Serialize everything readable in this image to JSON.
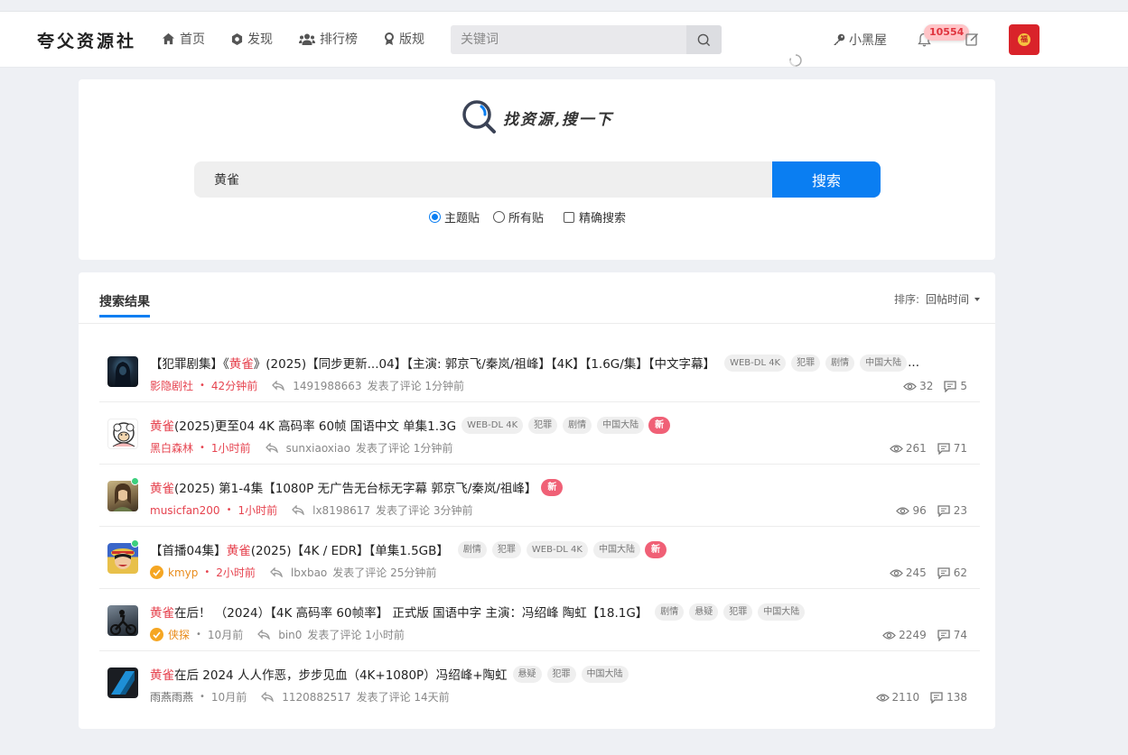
{
  "header": {
    "logo": "夸父资源社",
    "nav": [
      {
        "label": "首页",
        "icon": "home-icon"
      },
      {
        "label": "发现",
        "icon": "compass-icon"
      },
      {
        "label": "排行榜",
        "icon": "users-icon"
      },
      {
        "label": "版规",
        "icon": "badge-icon"
      }
    ],
    "search_placeholder": "关键词",
    "blackroom_label": "小黑屋",
    "notification_count": "10554"
  },
  "search_panel": {
    "title": "找资源,搜一下",
    "query": "黄雀",
    "button_label": "搜索",
    "options": {
      "topic_posts": "主题贴",
      "all_posts": "所有贴",
      "exact_search": "精确搜索"
    },
    "selected_option": "主题贴"
  },
  "results": {
    "tab_label": "搜索结果",
    "sort_label": "排序:",
    "sort_value": "回帖时间",
    "items": [
      {
        "title_pre": "【犯罪剧集】《",
        "title_hl": "黄雀",
        "title_post": "》(2025)【同步更新...04】【主演: 郭京飞/秦岚/祖峰】【4K】【1.6G/集】【中文字幕】",
        "tags": [
          "WEB-DL 4K",
          "犯罪",
          "剧情",
          "中国大陆"
        ],
        "tags_overflow": "...",
        "is_new": false,
        "author": "影隐剧社",
        "time": "42分钟前",
        "replier": "1491988663",
        "reply_action": "发表了评论 1分钟前",
        "views": "32",
        "comments": "5"
      },
      {
        "title_pre": "",
        "title_hl": "黄雀",
        "title_post": " (2025)更至04 4K 高码率 60帧 国语中文 单集1.3G",
        "tags": [
          "WEB-DL 4K",
          "犯罪",
          "剧情",
          "中国大陆"
        ],
        "is_new": true,
        "author": "黑白森林",
        "time": "1小时前",
        "replier": "sunxiaoxiao",
        "reply_action": "发表了评论 1分钟前",
        "views": "261",
        "comments": "71"
      },
      {
        "title_pre": "",
        "title_hl": "黄雀",
        "title_post": " (2025) 第1-4集【1080P 无广告无台标无字幕 郭京飞/秦岚/祖峰】",
        "tags": [],
        "is_new": true,
        "author": "musicfan200",
        "time": "1小时前",
        "replier": "lx8198617",
        "reply_action": "发表了评论 3分钟前",
        "views": "96",
        "comments": "23"
      },
      {
        "title_pre": "【首播04集】",
        "title_hl": "黄雀",
        "title_post": " (2025)【4K / EDR】【单集1.5GB】",
        "tags": [
          "剧情",
          "犯罪",
          "WEB-DL 4K",
          "中国大陆"
        ],
        "is_new": true,
        "author": "kmyp",
        "time": "2小时前",
        "replier": "lbxbao",
        "reply_action": "发表了评论 25分钟前",
        "views": "245",
        "comments": "62"
      },
      {
        "title_pre": "",
        "title_hl": "黄雀",
        "title_post": "在后！ （2024）【4K 高码率 60帧率】 正式版 国语中字 主演：冯绍峰 陶虹【18.1G】",
        "tags": [
          "剧情",
          "悬疑",
          "犯罪",
          "中国大陆"
        ],
        "is_new": false,
        "author": "侠探",
        "time": "10月前",
        "replier": "bin0",
        "reply_action": "发表了评论 1小时前",
        "views": "2249",
        "comments": "74"
      },
      {
        "title_pre": "",
        "title_hl": "黄雀",
        "title_post": "在后 2024 人人作恶，步步见血（4K+1080P）冯绍峰+陶虹",
        "tags": [
          "悬疑",
          "犯罪",
          "中国大陆"
        ],
        "is_new": false,
        "author": "雨燕雨燕",
        "time": "10月前",
        "replier": "1120882517",
        "reply_action": "发表了评论 14天前",
        "views": "2110",
        "comments": "138"
      }
    ],
    "new_badge": "新"
  },
  "colors": {
    "accent": "#0a7ef2",
    "highlight": "#e6434f",
    "new_badge": "#f06076"
  }
}
